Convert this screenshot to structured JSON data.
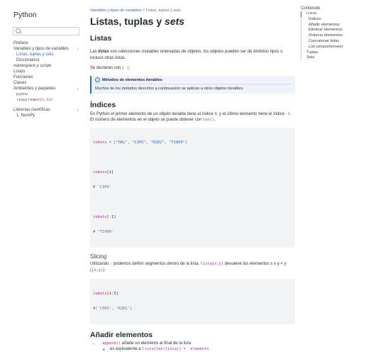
{
  "site": {
    "title": "Python",
    "search_placeholder": ""
  },
  "sidebar": {
    "items": [
      {
        "label": "Preface"
      },
      {
        "label": "Variables y tipos de variables",
        "chevron": "⌄"
      },
      {
        "label": "Listas, tuplas y sets"
      },
      {
        "label": "Diccionarios"
      },
      {
        "label": "namespace y scope"
      },
      {
        "label": "Loops"
      },
      {
        "label": "Funciones"
      },
      {
        "label": "Clases"
      },
      {
        "label": "Ambientes y paquetes",
        "chevron": "⌄"
      },
      {
        "label": "pyenv"
      },
      {
        "label": "requirements.txt"
      },
      {
        "label": "Librerías científicas",
        "chevron": "⌄"
      },
      {
        "label": "1  NumPy"
      }
    ]
  },
  "breadcrumb": {
    "parent": "Variables y tipos de variables",
    "separator": ">",
    "current": "Listas, tuplas y sets"
  },
  "page": {
    "title_main": "Listas, tuplas y ",
    "title_em": "sets"
  },
  "content": {
    "h_listas": "Listas",
    "p1_a": "Las ",
    "p1_b": "listas",
    "p1_c": " son colecciones ",
    "p1_d": "mutables",
    "p1_e": " ordenadas de objetos; los objetos pueden ser de distintos tipos o incluso otras listas.",
    "p2_a": "Se declaran con ",
    "p2_code": "[ ]",
    "p2_b": ".",
    "callout_title": "Métodos de elementos iterables",
    "callout_body": "Muchos de los métodos descritos a continuación se aplican a otros objetos iterables.",
    "h_indices": "Índices",
    "p3_a": "En Python el primer elemento de un objeto iterable tiene el índice ",
    "p3_code1": "0",
    "p3_b": ", y el último elemento tiene el índice ",
    "p3_code2": "-1",
    "p3_c": ". El número de elementos en el objeto se puede obtener con ",
    "p3_code3": "len()",
    "p3_d": ".",
    "code1": {
      "l1_var": "robots",
      "l1_rest": " = [\"HAL\", \"C3PO\", \"R2D2\", \"T1000\"]",
      "l2_var": "robots",
      "l2_rest": "[1]",
      "l3": "# 'C3PO'",
      "l4_var": "robots",
      "l4_rest": "[-1]",
      "l5": "# 'T1000'"
    },
    "h_slicing": "Slicing",
    "p4_a": "Utilizando ",
    "p4_code1": ":",
    "p4_b": " podemos definir segmentos dentro de la lista. ",
    "p4_code2": "lista[x:y]",
    "p4_c": " devuelve los elementos ",
    "p4_d": "≥ x y < y",
    "p4_e": " (",
    "p4_code3": "[x,y)",
    "p4_f": ")",
    "code2": {
      "l1_var": "robots",
      "l1_rest": "[1:3]",
      "l2": "#['C3PO', 'R2D2']"
    },
    "h_anadir": "Añadir elementos",
    "li1_code": ".append()",
    "li1_text": " añade un elemento al final de la lista",
    "li2_text": "es equivalente a ",
    "li2_code": "lista[len(lista)] = 'elemento"
  },
  "toc": {
    "title": "Contenido",
    "items": [
      {
        "label": "Listas"
      },
      {
        "label": "Índices"
      },
      {
        "label": "Añadir elementos"
      },
      {
        "label": "Eliminar elementos"
      },
      {
        "label": "Ordenar elementos"
      },
      {
        "label": "Concatenar listas"
      },
      {
        "label": "List comprehension"
      },
      {
        "label": "Tuplas"
      },
      {
        "label": "Sets"
      }
    ]
  },
  "colors": {
    "accent": "#2a6bcb",
    "code_inline": "#b0288e",
    "code_bg": "#f2f3f5",
    "callout_bg": "#eef3fb"
  }
}
